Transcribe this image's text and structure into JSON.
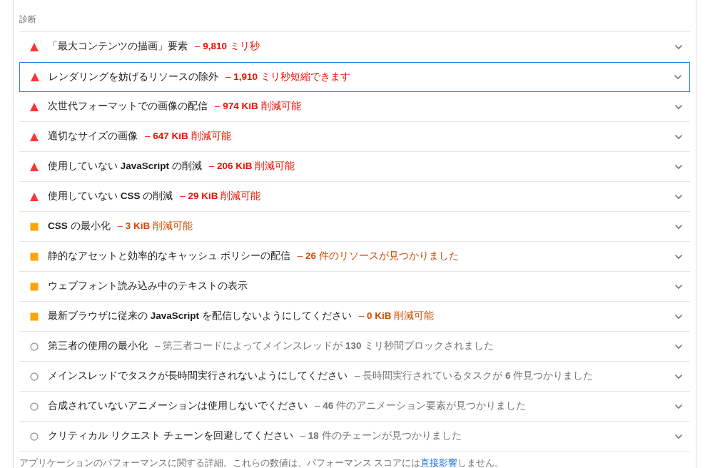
{
  "section_title": "診断",
  "audits": [
    {
      "kind": "fail",
      "title": "「最大コンテンツの描画」要素",
      "summary": "– **9,810** ミリ秒",
      "focused": false
    },
    {
      "kind": "fail",
      "title": "レンダリングを妨げるリソースの除外",
      "summary": "– **1,910** ミリ秒短縮できます",
      "focused": true
    },
    {
      "kind": "fail",
      "title": "次世代フォーマットでの画像の配信",
      "summary": "– **974 KiB** 削減可能",
      "focused": false
    },
    {
      "kind": "fail",
      "title": "適切なサイズの画像",
      "summary": "– **647 KiB** 削減可能",
      "focused": false
    },
    {
      "kind": "fail",
      "title": "使用していない **JavaScript** の削減",
      "summary": "– **206 KiB** 削減可能",
      "focused": false
    },
    {
      "kind": "fail",
      "title": "使用していない **CSS** の削減",
      "summary": "– **29 KiB** 削減可能",
      "focused": false
    },
    {
      "kind": "average",
      "title": "**CSS** の最小化",
      "summary": "– **3 KiB** 削減可能",
      "focused": false
    },
    {
      "kind": "average",
      "title": "静的なアセットと効率的なキャッシュ ポリシーの配信",
      "summary": "– **26** 件のリソースが見つかりました",
      "focused": false
    },
    {
      "kind": "average",
      "title": "ウェブフォント読み込み中のテキストの表示",
      "focused": false
    },
    {
      "kind": "average",
      "title": "最新ブラウザに従来の **JavaScript** を配信しないようにしてください",
      "summary": "– **0 KiB** 削減可能",
      "focused": false
    },
    {
      "kind": "info",
      "title": "第三者の使用の最小化",
      "summary": "– 第三者コードによってメインスレッドが **130** ミリ秒間ブロックされました",
      "focused": false
    },
    {
      "kind": "info",
      "title": "メインスレッドでタスクが長時間実行されないようにしてください",
      "summary": "– 長時間実行されているタスクが **6** 件見つかりました",
      "focused": false
    },
    {
      "kind": "info",
      "title": "合成されていないアニメーションは使用しないでください",
      "summary": "– **46** 件のアニメーション要素が見つかりました",
      "focused": false
    },
    {
      "kind": "info",
      "title": "クリティカル リクエスト チェーンを回避してください",
      "summary": "– **18** 件のチェーンが見つかりました",
      "focused": false
    }
  ],
  "footer": {
    "text": "アプリケーションのパフォーマンスに関する詳細。これらの数値は、パフォーマンス スコアには",
    "link": "直接影響",
    "text_after": "しません。"
  }
}
